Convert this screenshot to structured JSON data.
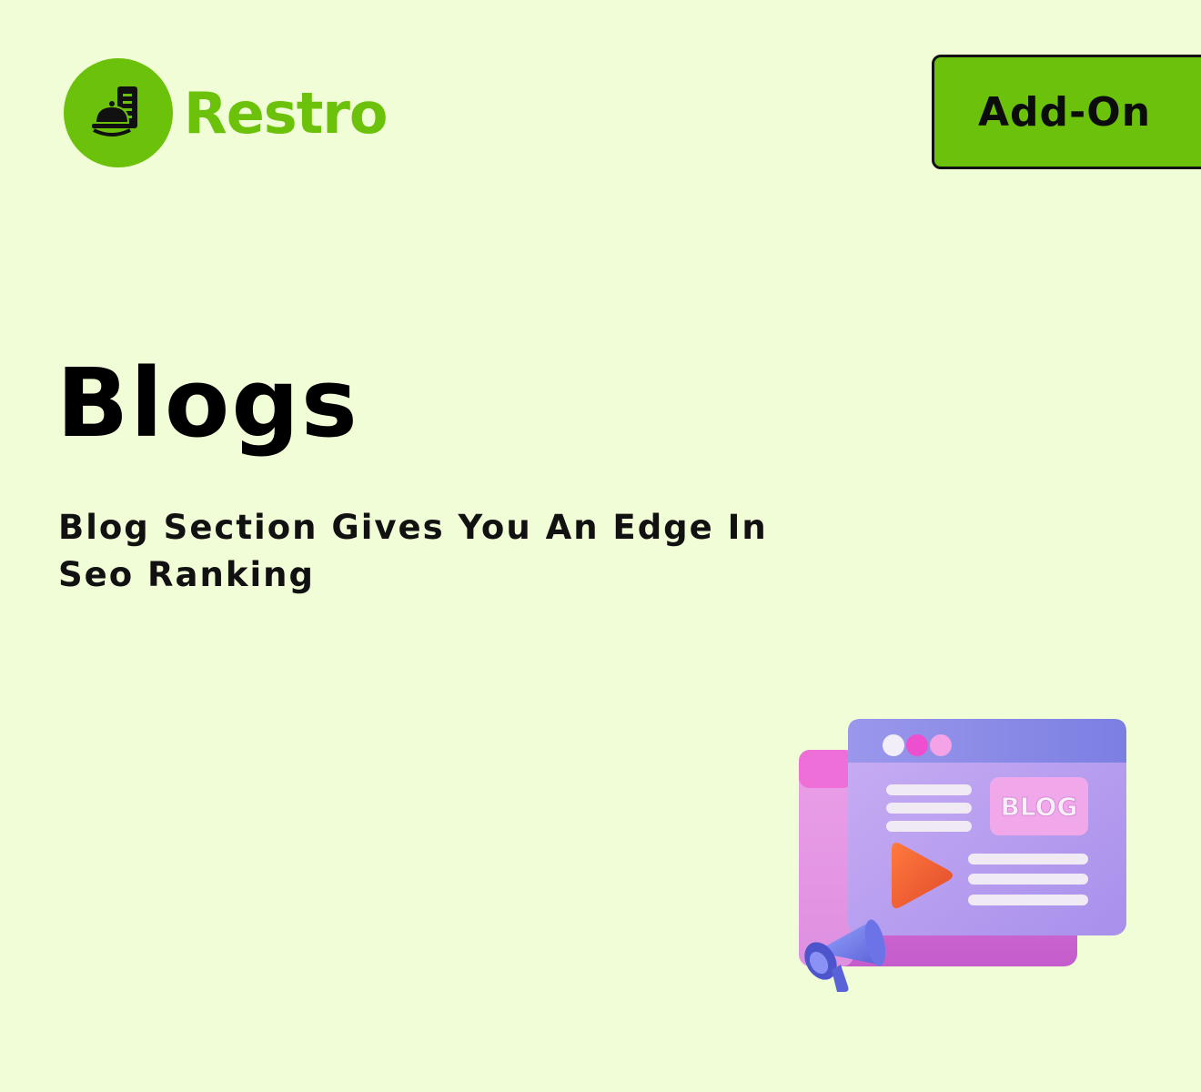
{
  "brand": {
    "name": "Restro",
    "color": "#6cc20a"
  },
  "header": {
    "addon_label": "Add-On"
  },
  "hero": {
    "title": "Blogs",
    "subtitle": "Blog Section Gives You An Edge In Seo Ranking"
  },
  "illustration": {
    "badge_text": "BLOG",
    "icon": "blog-browser-illustration"
  },
  "colors": {
    "background": "#f1fdd6",
    "accent": "#6cc20a",
    "text": "#000000"
  }
}
